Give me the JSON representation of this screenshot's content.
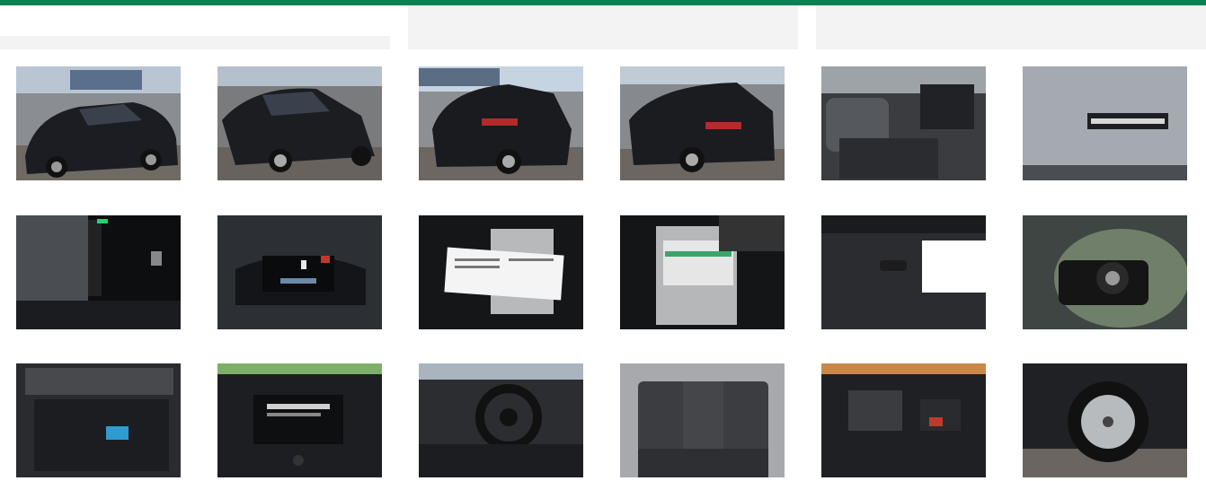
{
  "colors": {
    "accent_bar": "#0b8050",
    "column_header_bg": "#f3f3f3",
    "car_body": "#1b1d22"
  },
  "gallery": {
    "columns": 3,
    "thumbnails": [
      {
        "view": "exterior-front-left",
        "icon": "car-front-icon"
      },
      {
        "view": "exterior-front-right",
        "icon": "car-front-icon"
      },
      {
        "view": "exterior-rear-left",
        "icon": "car-rear-icon"
      },
      {
        "view": "exterior-rear-right",
        "icon": "car-rear-icon"
      },
      {
        "view": "interior-front-seats",
        "icon": "seat-icon"
      },
      {
        "view": "windshield-vin-plate",
        "icon": "plate-icon"
      },
      {
        "view": "instrument-dark",
        "icon": "gauge-icon"
      },
      {
        "view": "instrument-cluster",
        "icon": "gauge-icon"
      },
      {
        "view": "manual-open",
        "icon": "manual-icon"
      },
      {
        "view": "manual-folder",
        "icon": "manual-icon"
      },
      {
        "view": "key-on-carpet",
        "icon": "key-icon"
      },
      {
        "view": "spare-wheel-well",
        "icon": "tire-icon"
      },
      {
        "view": "trunk",
        "icon": "trunk-icon"
      },
      {
        "view": "infotainment-screen",
        "icon": "screen-icon"
      },
      {
        "view": "steering-wheel",
        "icon": "steering-icon"
      },
      {
        "view": "rear-seats",
        "icon": "seat-icon"
      },
      {
        "view": "engine-bay",
        "icon": "engine-icon"
      },
      {
        "view": "wheel-rim",
        "icon": "tire-icon"
      }
    ]
  }
}
